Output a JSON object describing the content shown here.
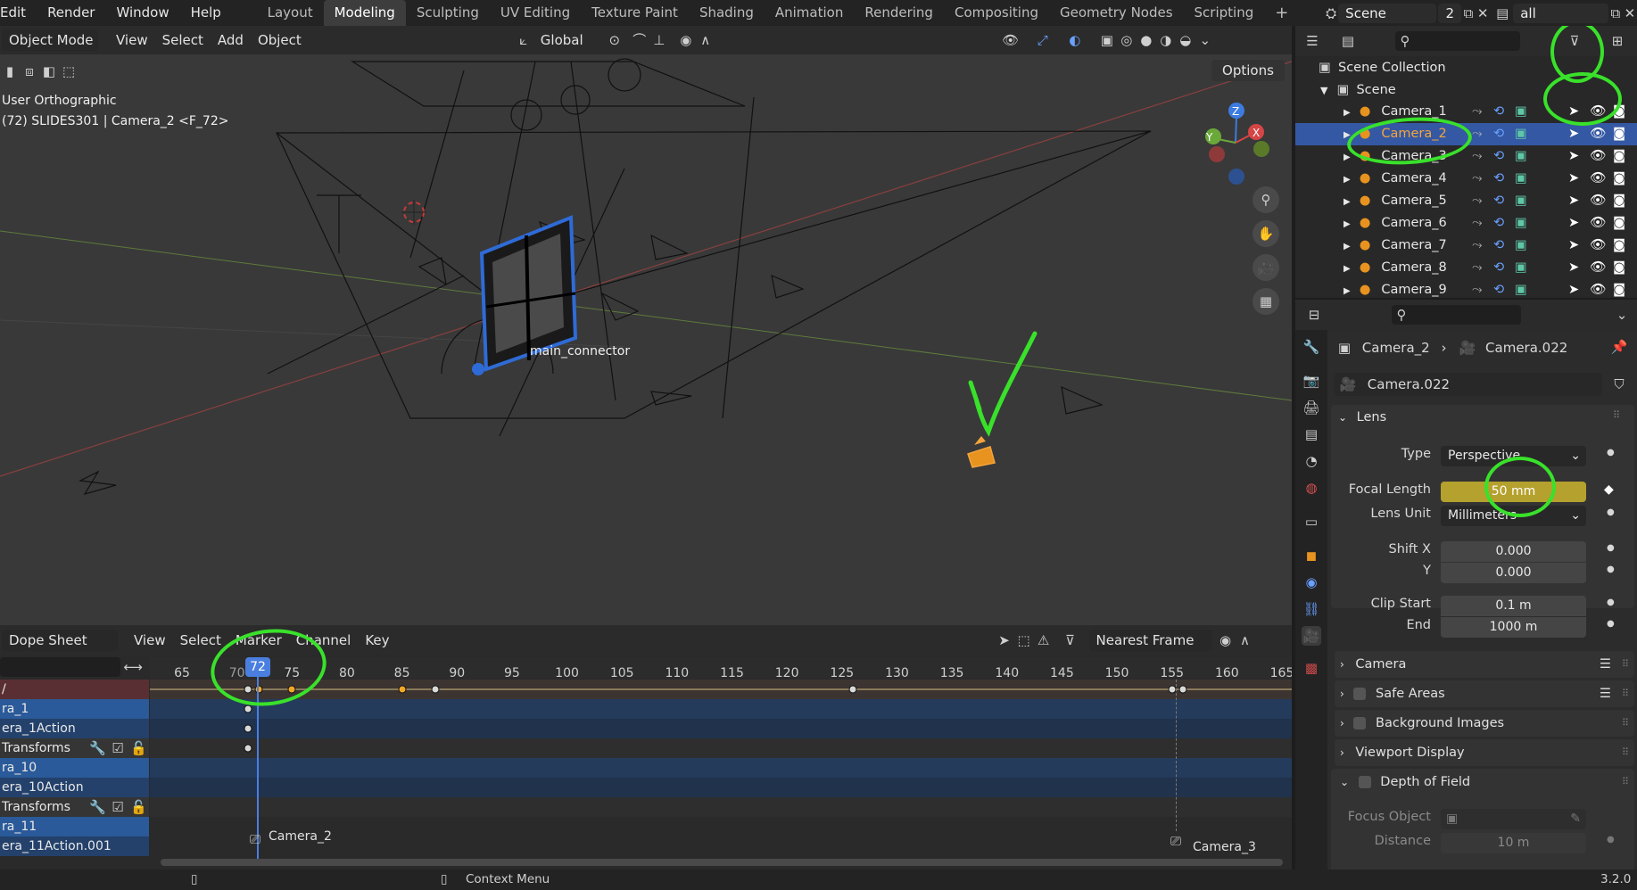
{
  "menus": [
    "Edit",
    "Render",
    "Window",
    "Help"
  ],
  "workspaces": [
    "Layout",
    "Modeling",
    "Sculpting",
    "UV Editing",
    "Texture Paint",
    "Shading",
    "Animation",
    "Rendering",
    "Compositing",
    "Geometry Nodes",
    "Scripting"
  ],
  "active_workspace": "Modeling",
  "scene": {
    "label": "Scene",
    "users": "2",
    "view_layer": "all"
  },
  "viewport": {
    "mode": "Object Mode",
    "menus": [
      "View",
      "Select",
      "Add",
      "Object"
    ],
    "orientation": "Global",
    "options": "Options",
    "view_name": "User Orthographic",
    "info": "(72) SLIDES301 | Camera_2 <F_72>",
    "object_label": "main_connector",
    "gizmo": {
      "z": "Z",
      "y": "Y",
      "x": "X"
    }
  },
  "dopesheet": {
    "mode": "Dope Sheet",
    "menus": [
      "View",
      "Select",
      "Marker",
      "Channel",
      "Key"
    ],
    "snap": "Nearest Frame",
    "current_frame": "72",
    "ticks": [
      "65",
      "70",
      "75",
      "80",
      "85",
      "90",
      "95",
      "100",
      "105",
      "110",
      "115",
      "120",
      "125",
      "130",
      "135",
      "140",
      "145",
      "150",
      "155",
      "160",
      "165"
    ],
    "channels": [
      "/",
      "ra_1",
      "era_1Action",
      "Transforms",
      "ra_10",
      "era_10Action",
      "Transforms",
      "ra_11",
      "era_11Action.001"
    ],
    "markers": [
      "Camera_2",
      "Camera_3"
    ]
  },
  "outliner": {
    "root": "Scene Collection",
    "scene": "Scene",
    "items": [
      "Camera_1",
      "Camera_2",
      "Camera_3",
      "Camera_4",
      "Camera_5",
      "Camera_6",
      "Camera_7",
      "Camera_8",
      "Camera_9"
    ],
    "selected": "Camera_2"
  },
  "properties": {
    "breadcrumb_object": "Camera_2",
    "breadcrumb_data": "Camera.022",
    "datablock": "Camera.022",
    "lens": {
      "title": "Lens",
      "type_label": "Type",
      "type": "Perspective",
      "focal_label": "Focal Length",
      "focal": "50 mm",
      "unit_label": "Lens Unit",
      "unit": "Millimeters",
      "shiftx_label": "Shift X",
      "shiftx": "0.000",
      "shifty_label": "Y",
      "shifty": "0.000",
      "clipstart_label": "Clip Start",
      "clipstart": "0.1 m",
      "clipend_label": "End",
      "clipend": "1000 m"
    },
    "sections": [
      "Camera",
      "Safe Areas",
      "Background Images",
      "Viewport Display",
      "Depth of Field"
    ],
    "dof": {
      "focus_label": "Focus Object",
      "distance_label": "Distance",
      "distance": "10 m"
    }
  },
  "status": {
    "context": "Context Menu",
    "version": "3.2.0"
  },
  "colors": {
    "selected_row": "#3458a3",
    "annotation": "#39e12b",
    "keyframe_selected": "#f2a826",
    "focal_field": "#b5a12d"
  }
}
